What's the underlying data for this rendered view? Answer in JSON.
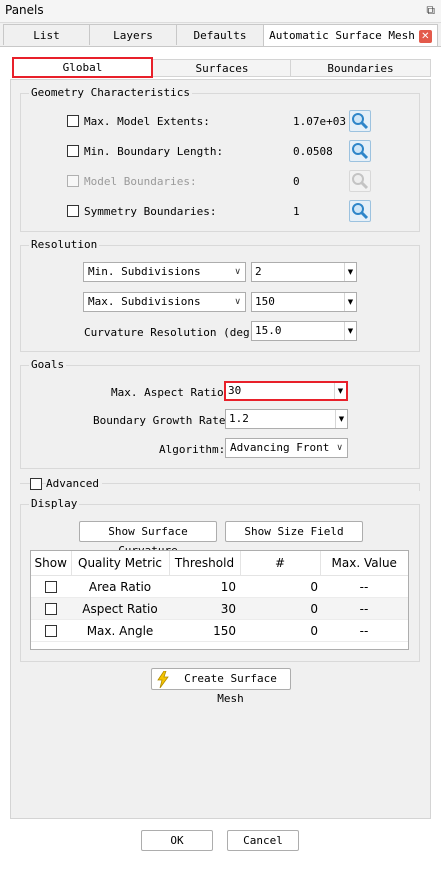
{
  "titlebar": {
    "title": "Panels",
    "pin_glyph": "⧉"
  },
  "tabs": [
    "List",
    "Layers",
    "Defaults",
    "Automatic Surface Mesh"
  ],
  "close_glyph": "✕",
  "subtabs": [
    "Global",
    "Surfaces",
    "Boundaries"
  ],
  "geometry": {
    "label": "Geometry Characteristics",
    "rows": [
      {
        "label": "Max. Model Extents:",
        "value": "1.07e+03",
        "enabled": true
      },
      {
        "label": "Min. Boundary Length:",
        "value": "0.0508",
        "enabled": true
      },
      {
        "label": "Model Boundaries:",
        "value": "0",
        "enabled": false
      },
      {
        "label": "Symmetry Boundaries:",
        "value": "1",
        "enabled": true
      }
    ]
  },
  "resolution": {
    "label": "Resolution",
    "min_sub": {
      "option": "Min. Subdivisions",
      "value": "2"
    },
    "max_sub": {
      "option": "Max. Subdivisions",
      "value": "150"
    },
    "curv_label": "Curvature Resolution (deg):",
    "curv_value": "15.0"
  },
  "goals": {
    "label": "Goals",
    "aspect_label": "Max. Aspect Ratio:",
    "aspect_value": "30",
    "growth_label": "Boundary Growth Rate:",
    "growth_value": "1.2",
    "algo_label": "Algorithm:",
    "algo_value": "Advancing Front"
  },
  "advanced_label": "Advanced",
  "display": {
    "label": "Display",
    "btn_curv": "Show Surface Curvature",
    "btn_size": "Show Size Field",
    "headers": [
      "Show",
      "Quality Metric",
      "Threshold",
      "#",
      "Max. Value"
    ],
    "rows": [
      {
        "metric": "Area Ratio",
        "threshold": "10",
        "count": "0",
        "max": "--"
      },
      {
        "metric": "Aspect Ratio",
        "threshold": "30",
        "count": "0",
        "max": "--"
      },
      {
        "metric": "Max. Angle",
        "threshold": "150",
        "count": "0",
        "max": "--"
      }
    ]
  },
  "create_btn": "Create Surface Mesh",
  "ok": "OK",
  "cancel": "Cancel",
  "colors": {
    "highlight": "#e8202a",
    "bolt": "#f5c400",
    "magnifier": "#2f86c9"
  }
}
